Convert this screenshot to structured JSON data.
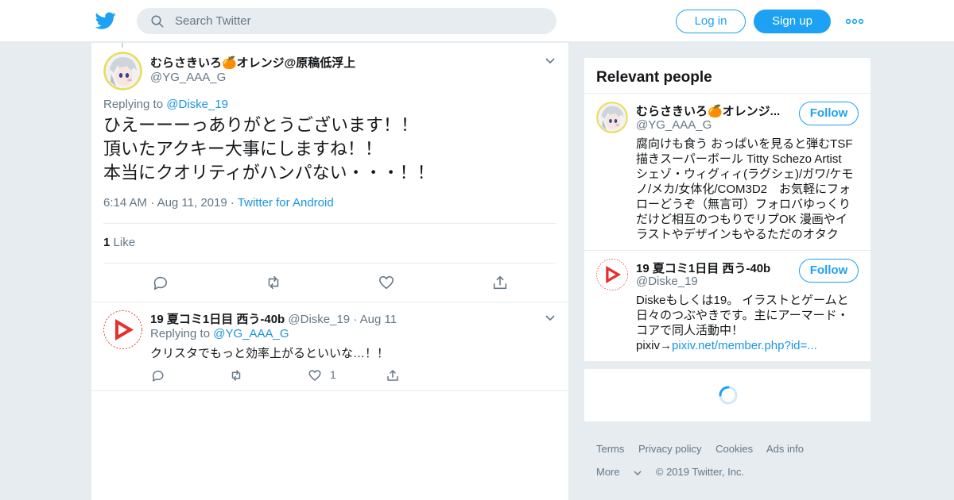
{
  "header": {
    "search_placeholder": "Search Twitter",
    "login_label": "Log in",
    "signup_label": "Sign up"
  },
  "tweet": {
    "display_name": "むらさきいろ🍊オレンジ@原稿低浮上",
    "handle": "@YG_AAA_G",
    "replying_prefix": "Replying to",
    "replying_handle": "@Diske_19",
    "lines": [
      "ひえーーーっありがとうございます！！",
      "頂いたアクキー大事にしますね！！",
      "本当にクオリティがハンパない・・・！！"
    ],
    "time": "6:14 AM",
    "date": "Aug 11, 2019",
    "source": "Twitter for Android",
    "like_count": "1",
    "like_label": "Like"
  },
  "reply": {
    "display_name": "19 夏コミ1日目 西う-40b",
    "handle": "@Diske_19",
    "date": "Aug 11",
    "replying_prefix": "Replying to",
    "replying_handle": "@YG_AAA_G",
    "text": "クリスタでもっと効率上がるといいな…！！",
    "like_count": "1"
  },
  "relevant": {
    "title": "Relevant people",
    "people": [
      {
        "name": "むらさきいろ🍊オレンジ...",
        "handle": "@YG_AAA_G",
        "follow_label": "Follow",
        "bio_lines": [
          "腐向けも食う おっぱいを見ると弾むTSF",
          "描きスーパーボール Titty Schezo Artist",
          "シェゾ・ウィグィィ(ラグシェ)/ガワ/ケモ",
          "ノ/メカ/女体化/COM3D2　お気軽にフォ",
          "ローどうぞ（無言可）フォロバゆっくり",
          "だけど相互のつもりでリプOK 漫画やイ",
          "ラストやデザインもやるただのオタク"
        ]
      },
      {
        "name": "19 夏コミ1日目 西う-40b",
        "handle": "@Diske_19",
        "follow_label": "Follow",
        "bio_lines": [
          "Diskeもしくは19。 イラストとゲームと",
          "日々のつぶやきです。主にアーマード・",
          "コアで同人活動中！"
        ],
        "bio_prefix": "pixiv→",
        "bio_link": "pixiv.net/member.php?id=..."
      }
    ]
  },
  "footer": {
    "links": [
      "Terms",
      "Privacy policy",
      "Cookies",
      "Ads info"
    ],
    "more_label": "More",
    "copyright": "© 2019 Twitter, Inc."
  },
  "colors": {
    "brand": "#1da1f2",
    "link": "#1b95e0",
    "muted": "#657786",
    "background": "#e6ecf0"
  }
}
